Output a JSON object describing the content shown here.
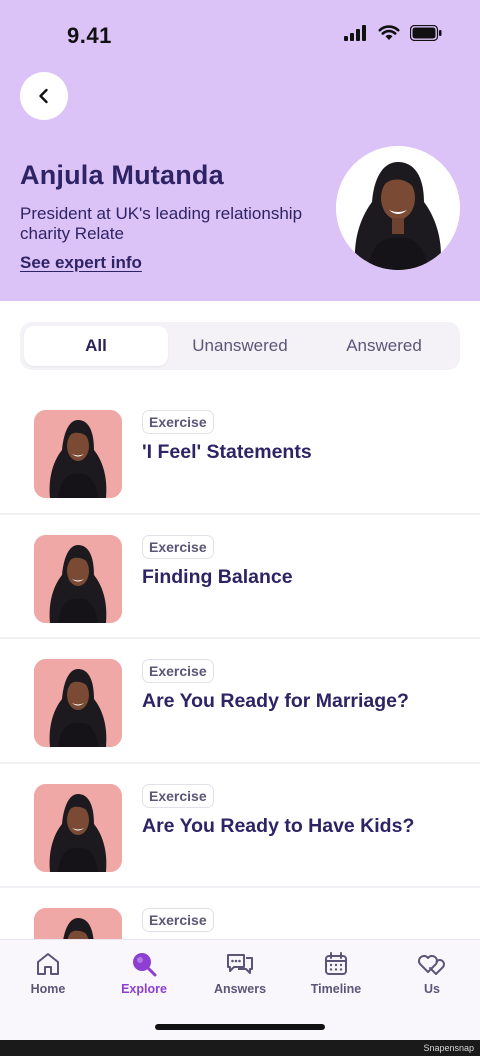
{
  "status_bar": {
    "time": "9.41"
  },
  "expert": {
    "name": "Anjula Mutanda",
    "bio": "President at UK's leading relationship charity Relate",
    "link_label": "See expert info"
  },
  "tabs": [
    {
      "label": "All",
      "active": true
    },
    {
      "label": "Unanswered",
      "active": false
    },
    {
      "label": "Answered",
      "active": false
    }
  ],
  "items": [
    {
      "badge": "Exercise",
      "title": "'I Feel' Statements"
    },
    {
      "badge": "Exercise",
      "title": "Finding Balance"
    },
    {
      "badge": "Exercise",
      "title": "Are You Ready for Marriage?"
    },
    {
      "badge": "Exercise",
      "title": "Are You Ready to Have Kids?"
    },
    {
      "badge": "Exercise",
      "title": ""
    }
  ],
  "bottom_nav": [
    {
      "label": "Home",
      "icon": "home-icon",
      "active": false
    },
    {
      "label": "Explore",
      "icon": "explore-icon",
      "active": true
    },
    {
      "label": "Answers",
      "icon": "answers-icon",
      "active": false
    },
    {
      "label": "Timeline",
      "icon": "calendar-icon",
      "active": false
    },
    {
      "label": "Us",
      "icon": "hearts-icon",
      "active": false
    }
  ],
  "watermark": "Snapensnap",
  "colors": {
    "header_bg": "#dcc3f7",
    "accent": "#8c3fd0",
    "text_primary": "#2e2365",
    "thumb_bg": "#f0a8a6"
  }
}
